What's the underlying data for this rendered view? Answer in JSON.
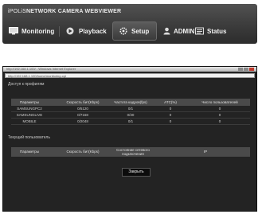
{
  "header": {
    "brand": "iPOLiS",
    "title": "NETWORK CAMERA WEBVIEWER",
    "nav": [
      {
        "label": "Monitoring",
        "icon": "monitor-icon"
      },
      {
        "label": "Playback",
        "icon": "play-icon"
      },
      {
        "label": "Setup",
        "icon": "gear-icon",
        "active": true
      },
      {
        "label": "ADMIN",
        "icon": "user-icon"
      },
      {
        "label": "Status",
        "icon": "status-icon"
      }
    ]
  },
  "window": {
    "title": "http://192.168.1.100/ - Windows Internet Explorer",
    "address": "http://192.168.1.100/home/monitoring.cgi",
    "access_section": "Доступ к профилям",
    "access_table": {
      "columns": [
        "Параметры",
        "Скорость бит(Kbps)",
        "Частота кадров(fps)",
        "ATC(%)",
        "Число пользователей"
      ],
      "rows": [
        [
          "SAMSUNGPC2",
          "0/5120",
          "0/1",
          "0",
          "0"
        ],
        [
          "SAMSUNGLIVE",
          "0/7168",
          "0/30",
          "0",
          "0"
        ],
        [
          "MOBILE",
          "0/2048",
          "0/1",
          "0",
          "0"
        ]
      ]
    },
    "users_section": "Текущий пользователь",
    "users_table": {
      "columns": [
        "Параметры",
        "Скорость бит(Kbps)",
        "Состояние сетевого подключения",
        "IP"
      ]
    },
    "close_label": "Закрыть"
  },
  "colors": {
    "header_bg": "#3f3f3f",
    "window_bg": "#232323",
    "table_header_bg": "#4a4a4a"
  }
}
